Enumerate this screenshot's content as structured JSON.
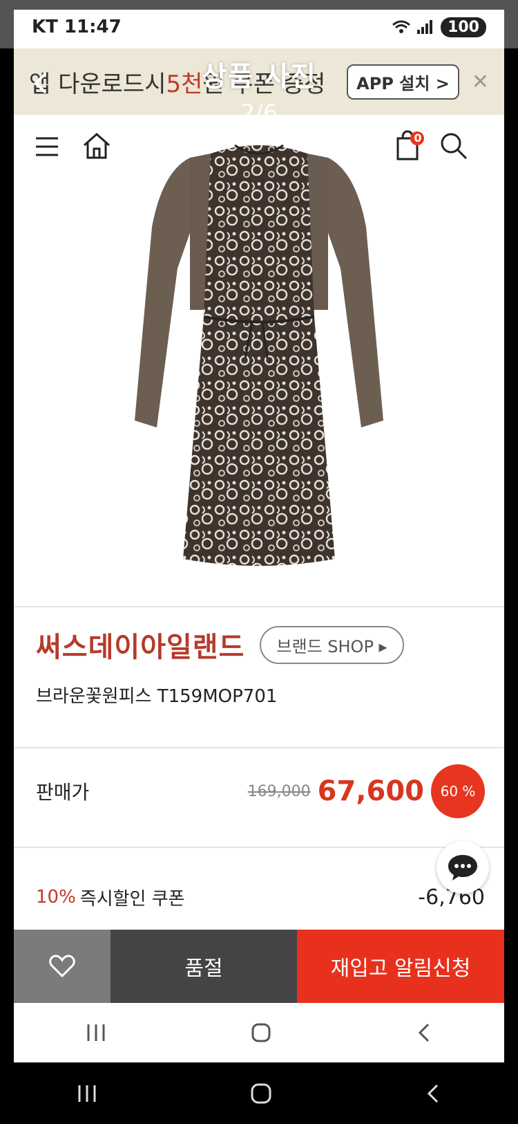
{
  "status_bar": {
    "carrier": "KT 11:47",
    "battery": "100"
  },
  "overlay": {
    "title": "상품 사진",
    "counter": "2/6"
  },
  "banner": {
    "text_prefix": "앱 다운로드시 ",
    "text_highlight": "5천",
    "text_suffix": " 원 쿠폰 증정",
    "app_button": "APP 설치 >"
  },
  "header": {
    "cart_count": "0"
  },
  "product": {
    "brand": "써스데이아일랜드",
    "brand_shop_button": "브랜드 SHOP ▸",
    "name": "브라운꽃원피스 T159MOP701"
  },
  "price": {
    "label": "판매가",
    "original": "169,000",
    "sale": "67,600",
    "discount": "60 %"
  },
  "coupon": {
    "percent": "10%",
    "label": "즉시할인 쿠폰",
    "amount": "-6,760"
  },
  "bottom_bar": {
    "soldout": "품절",
    "restock": "재입고 알림신청"
  },
  "colors": {
    "accent": "#e8311d",
    "brand": "#b63a2a",
    "banner_bg": "#ece7d6"
  }
}
